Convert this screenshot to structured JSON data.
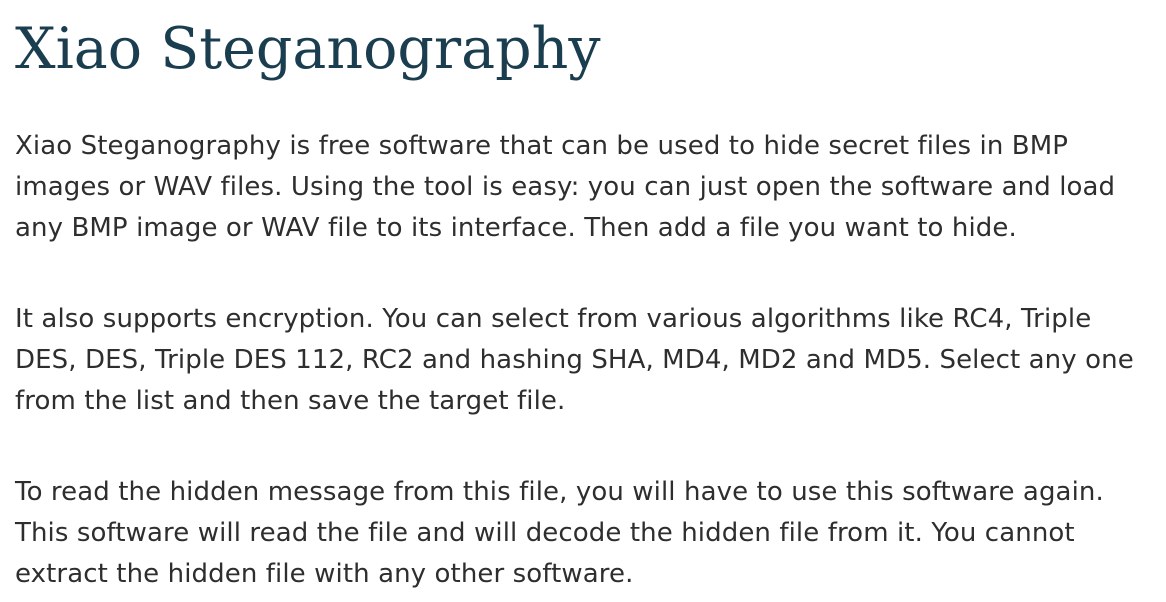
{
  "article": {
    "title": "Xiao Steganography",
    "paragraphs": [
      "Xiao Steganography is free software that can be used to hide secret files in BMP images or WAV files. Using the tool is easy: you can just open the software and load any BMP image or WAV file to its interface. Then add a file you want to hide.",
      "It also supports encryption. You can select from various algorithms like RC4, Triple DES, DES, Triple DES 112, RC2 and hashing SHA, MD4, MD2 and MD5. Select any one from the list and then save the target file.",
      "To read the hidden message from this file, you will have to use this software again. This software will read the file and will decode the hidden file from it. You cannot extract the hidden file with any other software."
    ]
  },
  "colors": {
    "title": "#1a3d4f",
    "body_text": "#2e2e2e",
    "background": "#ffffff"
  }
}
